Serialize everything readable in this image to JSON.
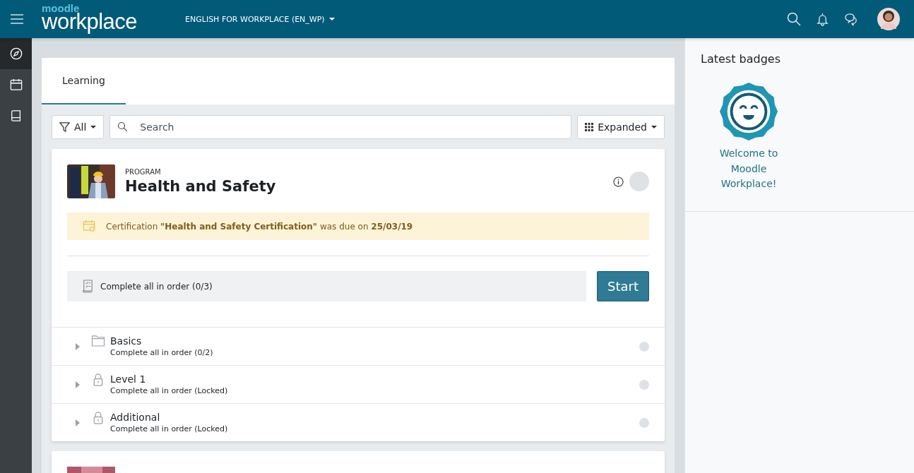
{
  "header": {
    "logo_small": "moodle",
    "logo_large": "workplace",
    "course_menu": "ENGLISH FOR WORKPLACE (EN_WP)"
  },
  "sidebar": {
    "items": [
      {
        "kind": "compass",
        "selected": true
      },
      {
        "kind": "calendar",
        "selected": false
      },
      {
        "kind": "book",
        "selected": false
      }
    ]
  },
  "tabs": [
    {
      "label": "Learning",
      "selected": true
    }
  ],
  "toolbar": {
    "filter": "All",
    "search_placeholder": "Search",
    "view": "Expanded"
  },
  "program": {
    "type_label": "PROGRAM",
    "title": "Health and Safety",
    "notice": "Certification **\"Health and Safety Certification\"** was due on **25/03/19**",
    "completion": "Complete all in order (0/3)",
    "start_button": "Start",
    "sets": [
      {
        "kind": "folder",
        "title": "Basics",
        "subtitle": "Complete all in order (0/2)",
        "expanded": false
      },
      {
        "kind": "lock",
        "title": "Level 1",
        "subtitle": "Complete all in order (Locked)",
        "expanded": false
      },
      {
        "kind": "lock",
        "title": "Additional",
        "subtitle": "Complete all in order (Locked)",
        "expanded": false
      }
    ]
  },
  "badges": {
    "title": "Latest badges",
    "items": [
      {
        "name": "Welcome to Moodle Workplace!"
      }
    ]
  }
}
